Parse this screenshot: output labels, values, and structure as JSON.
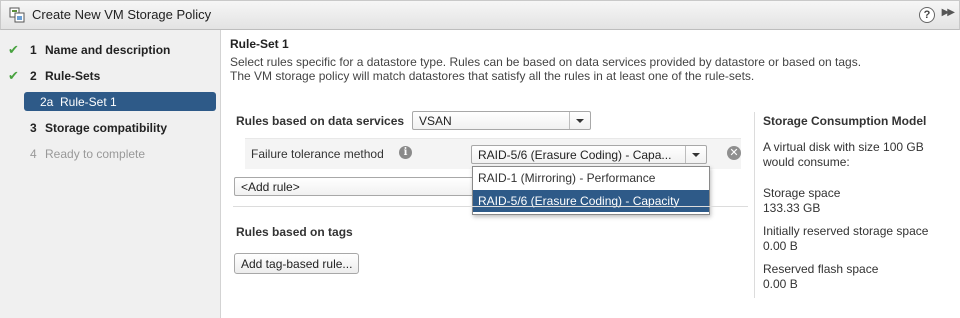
{
  "window": {
    "title": "Create New VM Storage Policy",
    "help_label": "?",
    "expand_label": "▶▶"
  },
  "sidebar": {
    "steps": [
      {
        "num": "1",
        "label": "Name and description",
        "state": "done"
      },
      {
        "num": "2",
        "label": "Rule-Sets",
        "state": "done"
      },
      {
        "num": "2a",
        "label": "Rule-Set 1",
        "state": "selected"
      },
      {
        "num": "3",
        "label": "Storage compatibility",
        "state": "current"
      },
      {
        "num": "4",
        "label": "Ready to complete",
        "state": "disabled"
      }
    ]
  },
  "main": {
    "heading": "Rule-Set 1",
    "description_line1": "Select rules specific for a datastore type. Rules can be based on data services provided by datastore or based on tags.",
    "description_line2": "The VM storage policy will match datastores that satisfy all the rules in at least one of the rule-sets.",
    "data_services_label": "Rules based on data services",
    "data_services_value": "VSAN",
    "rule": {
      "label": "Failure tolerance method",
      "value": "RAID-5/6 (Erasure Coding) - Capa...",
      "options": [
        {
          "label": "RAID-1 (Mirroring) - Performance",
          "selected": false
        },
        {
          "label": "RAID-5/6 (Erasure Coding) - Capacity",
          "selected": true
        }
      ]
    },
    "add_rule_value": "<Add rule>",
    "tags_label": "Rules based on tags",
    "add_tag_button": "Add tag-based rule..."
  },
  "consumption": {
    "title": "Storage Consumption Model",
    "intro_line1": "A virtual disk with size 100 GB",
    "intro_line2": "would consume:",
    "storage_space_label": "Storage space",
    "storage_space_value": "133.33 GB",
    "reserved_storage_label": "Initially reserved storage space",
    "reserved_storage_value": "0.00 B",
    "reserved_flash_label": "Reserved flash space",
    "reserved_flash_value": "0.00 B"
  },
  "colors": {
    "selection": "#2e5a88",
    "check": "#48a23f"
  }
}
